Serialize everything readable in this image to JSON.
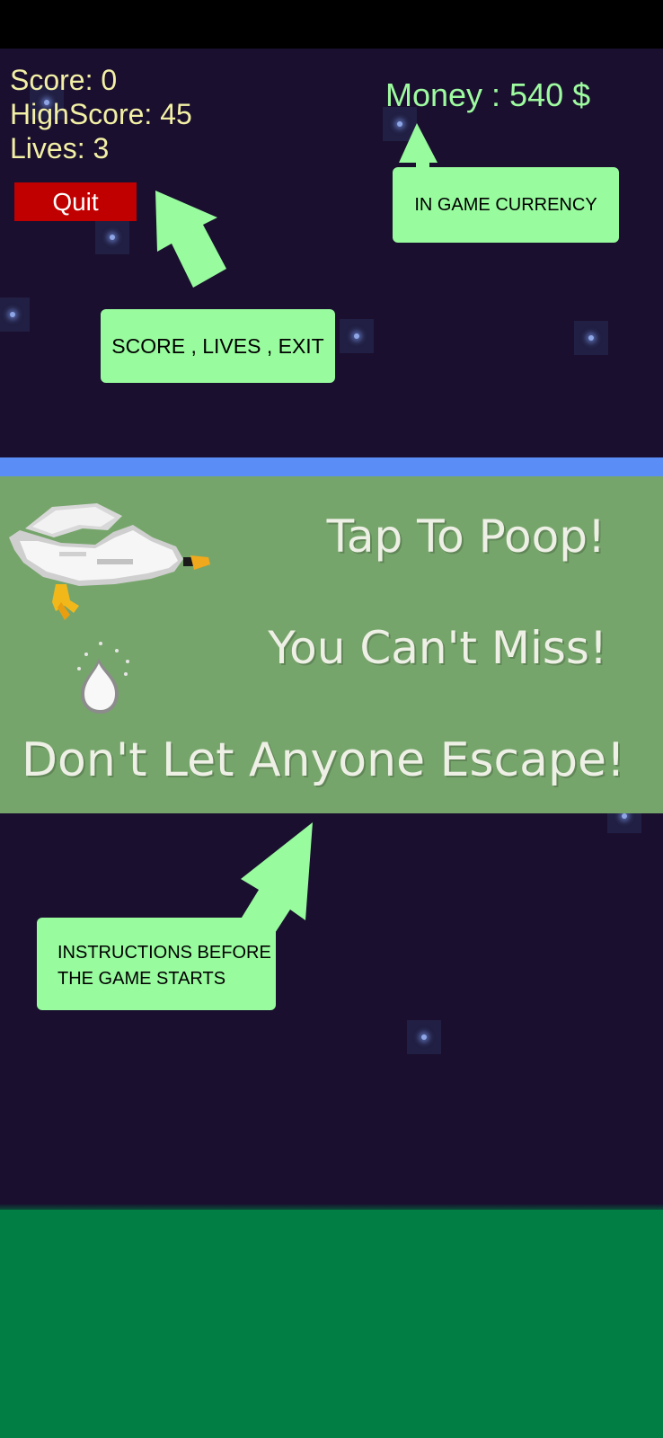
{
  "hud": {
    "score": "Score: 0",
    "highscore": "HighScore: 45",
    "lives": "Lives: 3",
    "quit_label": "Quit",
    "money": "Money : 540 $"
  },
  "banner": {
    "line1": "Tap To Poop!",
    "line2": "You Can't Miss!",
    "line3": "Don't Let Anyone Escape!"
  },
  "callouts": {
    "currency": "IN GAME CURRENCY",
    "score": "SCORE , LIVES , EXIT",
    "instructions_line1": "INSTRUCTIONS BEFORE",
    "instructions_line2": "THE GAME STARTS"
  },
  "colors": {
    "night_sky": "#1a0f2e",
    "ground": "#007e44",
    "banner_bg": "#76a56b",
    "banner_stripe": "#5a8ef6",
    "hud_text": "#f3f0a6",
    "money_text": "#9efba0",
    "quit_button": "#c00000",
    "callout": "#98fb9e"
  },
  "icons": {
    "bird": "pixel-seagull-icon",
    "poop": "poop-drop-icon",
    "stars": "twinkle-star-icon"
  }
}
